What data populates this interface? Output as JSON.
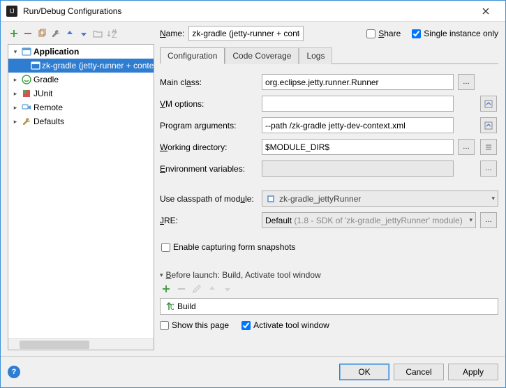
{
  "titlebar": {
    "title": "Run/Debug Configurations"
  },
  "name_label": "Name:",
  "name_value": "zk-gradle (jetty-runner + context)",
  "share_label": "Share",
  "single_instance_label": "Single instance only",
  "share_checked": false,
  "single_instance_checked": true,
  "tree": {
    "root": "Application",
    "selected": "zk-gradle (jetty-runner + context)",
    "items": [
      {
        "label": "Gradle",
        "expandable": true
      },
      {
        "label": "JUnit",
        "expandable": true
      },
      {
        "label": "Remote",
        "expandable": true
      },
      {
        "label": "Defaults",
        "expandable": true
      }
    ]
  },
  "tabs": {
    "active": "Configuration",
    "others": [
      "Code Coverage",
      "Logs"
    ]
  },
  "form": {
    "main_class_label": "Main class:",
    "main_class_value": "org.eclipse.jetty.runner.Runner",
    "vm_options_label": "VM options:",
    "vm_options_value": "",
    "program_args_label": "Program arguments:",
    "program_args_value": "--path /zk-gradle jetty-dev-context.xml",
    "working_dir_label": "Working directory:",
    "working_dir_value": "$MODULE_DIR$",
    "env_vars_label": "Environment variables:",
    "env_vars_value": "",
    "classpath_label": "Use classpath of module:",
    "classpath_value": "zk-gradle_jettyRunner",
    "jre_label": "JRE:",
    "jre_value": "Default (1.8 - SDK of 'zk-gradle_jettyRunner' module)",
    "enable_snapshots_label": "Enable capturing form snapshots"
  },
  "before_launch": {
    "header": "Before launch: Build, Activate tool window",
    "item": "Build",
    "show_page_label": "Show this page",
    "activate_tool_label": "Activate tool window"
  },
  "footer": {
    "ok": "OK",
    "cancel": "Cancel",
    "apply": "Apply"
  }
}
